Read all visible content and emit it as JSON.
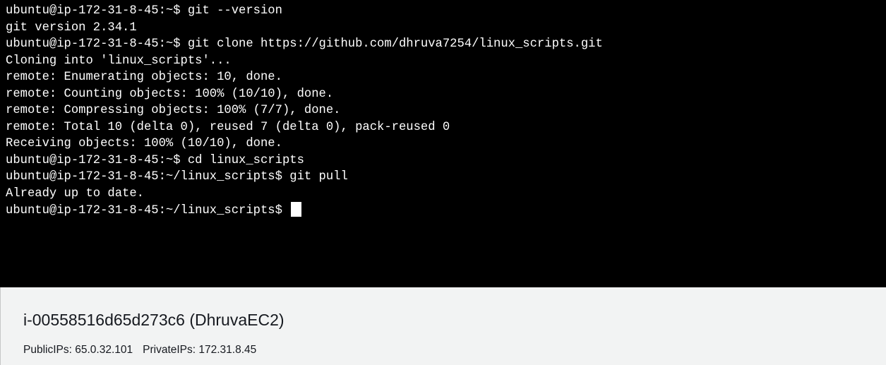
{
  "terminal": {
    "lines": [
      "ubuntu@ip-172-31-8-45:~$ git --version",
      "git version 2.34.1",
      "ubuntu@ip-172-31-8-45:~$ git clone https://github.com/dhruva7254/linux_scripts.git",
      "Cloning into 'linux_scripts'...",
      "remote: Enumerating objects: 10, done.",
      "remote: Counting objects: 100% (10/10), done.",
      "remote: Compressing objects: 100% (7/7), done.",
      "remote: Total 10 (delta 0), reused 7 (delta 0), pack-reused 0",
      "Receiving objects: 100% (10/10), done.",
      "ubuntu@ip-172-31-8-45:~$ cd linux_scripts",
      "ubuntu@ip-172-31-8-45:~/linux_scripts$ git pull",
      "Already up to date.",
      "ubuntu@ip-172-31-8-45:~/linux_scripts$ "
    ]
  },
  "instance": {
    "title": "i-00558516d65d273c6 (DhruvaEC2)",
    "public_ips_label": "PublicIPs:",
    "public_ips_value": "65.0.32.101",
    "private_ips_label": "PrivateIPs:",
    "private_ips_value": "172.31.8.45"
  },
  "colors": {
    "terminal_background": "#000000",
    "terminal_text": "#ffffff",
    "panel_background": "#f2f3f3",
    "panel_text": "#16191f"
  }
}
